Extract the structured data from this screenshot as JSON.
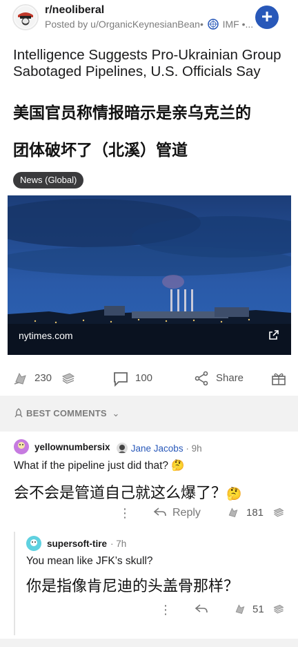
{
  "post": {
    "subreddit": "r/neoliberal",
    "posted_by": "Posted by u/OrganicKeynesianBean",
    "user_flair": "IMF",
    "title_en": "Intelligence Suggests Pro-Ukrainian Group Sabotaged Pipelines, U.S. Officials Say",
    "title_zh_line1": "美国官员称情报暗示是亲乌克兰的",
    "title_zh_line2": "团体破坏了（北溪）管道",
    "flair": "News (Global)",
    "link_domain": "nytimes.com"
  },
  "actions": {
    "votes": "230",
    "comments": "100",
    "share": "Share"
  },
  "sort": {
    "label": "BEST COMMENTS"
  },
  "comments": [
    {
      "user": "yellownumbersix",
      "flair": "Jane Jacobs",
      "age": "9h",
      "text_en": "What if the pipeline just did that?",
      "text_zh": "会不会是管道自己就这么爆了？",
      "reply_label": "Reply",
      "votes": "181"
    },
    {
      "user": "supersoft-tire",
      "age": "7h",
      "text_en": "You mean like JFK’s skull?",
      "text_zh": "你是指像肯尼迪的头盖骨那样？",
      "votes": "51"
    }
  ],
  "colors": {
    "accent": "#2858b9",
    "flair_bg": "#3a3a3c",
    "muted": "#7c7c7c"
  }
}
